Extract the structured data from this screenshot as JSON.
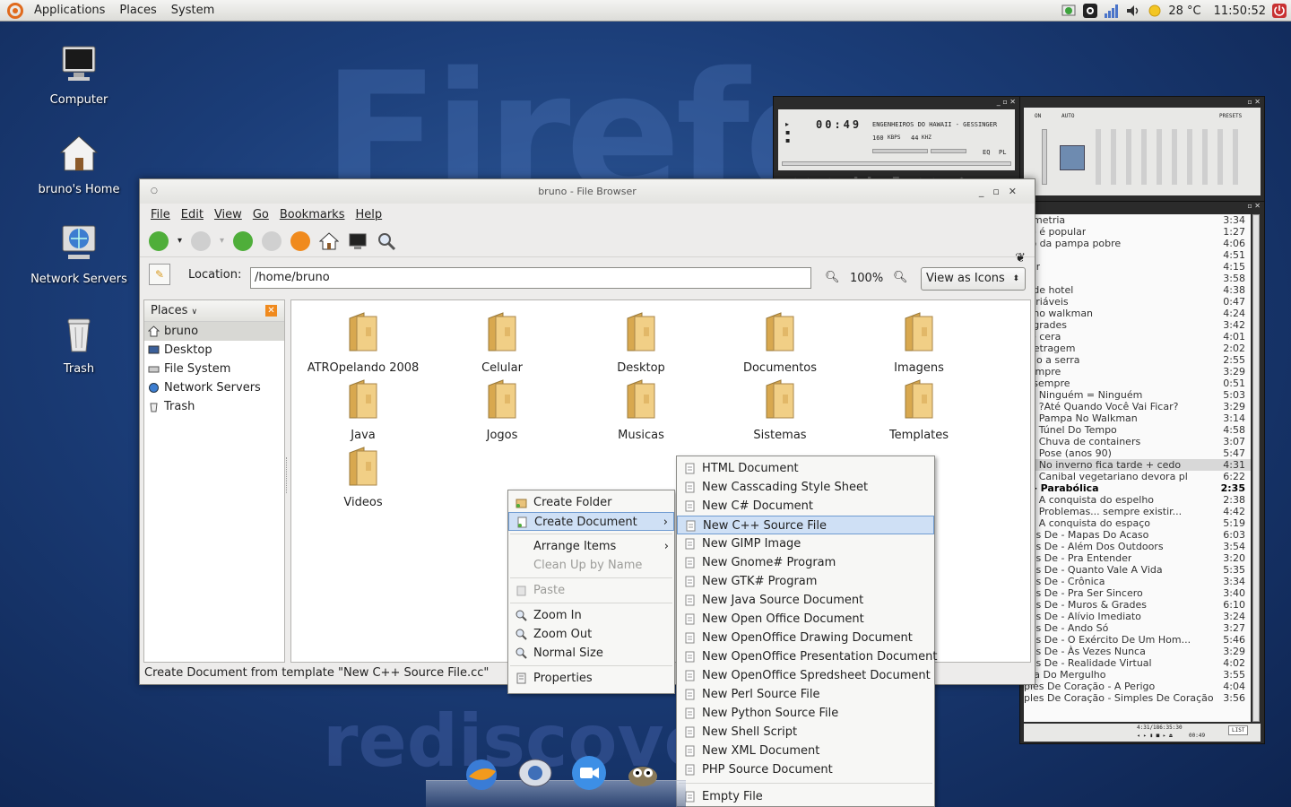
{
  "top_panel": {
    "menus": [
      "Applications",
      "Places",
      "System"
    ],
    "weather": "28 °C",
    "clock": "11:50:52"
  },
  "background": {
    "words": [
      "Firefox",
      "rediscover"
    ]
  },
  "desktop_icons": [
    {
      "label": "Computer",
      "icon": "computer-icon"
    },
    {
      "label": "bruno's Home",
      "icon": "home-icon"
    },
    {
      "label": "Network Servers",
      "icon": "network-icon"
    },
    {
      "label": "Trash",
      "icon": "trash-icon"
    }
  ],
  "player": {
    "time": "00:49",
    "title": "ENGENHEIROS DO HAWAII - GESSINGER",
    "kbps": "160",
    "kbps_unit": "KBPS",
    "khz": "44",
    "khz_unit": "KHZ",
    "eq": "EQ",
    "pl": "PL",
    "eq_on": "ON",
    "eq_auto": "AUTO",
    "eq_presets": "PRESETS"
  },
  "file_browser": {
    "title": "bruno - File Browser",
    "menus": [
      "File",
      "Edit",
      "View",
      "Go",
      "Bookmarks",
      "Help"
    ],
    "location_label": "Location:",
    "location": "/home/bruno",
    "zoom": "100%",
    "view_mode": "View as Icons",
    "sidebar_title": "Places",
    "places": [
      "bruno",
      "Desktop",
      "File System",
      "Network Servers",
      "Trash"
    ],
    "folders": [
      "ATROpelando 2008",
      "Celular",
      "Desktop",
      "Documentos",
      "Imagens",
      "Java",
      "Jogos",
      "Musicas",
      "Sistemas",
      "Templates",
      "Videos"
    ],
    "status": "Create Document from template \"New C++ Source File.cc\""
  },
  "context_menu": [
    {
      "label": "Create Folder",
      "enabled": true
    },
    {
      "label": "Create Document",
      "enabled": true,
      "submenu": true,
      "highlighted": true
    },
    {
      "label": "Arrange Items",
      "enabled": true,
      "submenu": true
    },
    {
      "label": "Clean Up by Name",
      "enabled": false
    },
    {
      "label": "Paste",
      "enabled": false
    },
    {
      "label": "Zoom In",
      "enabled": true
    },
    {
      "label": "Zoom Out",
      "enabled": true
    },
    {
      "label": "Normal Size",
      "enabled": true
    },
    {
      "label": "Properties",
      "enabled": true
    }
  ],
  "document_menu": [
    "HTML Document",
    "New Casscading Style Sheet",
    "New C# Document",
    "New C++ Source File",
    "New GIMP Image",
    "New Gnome# Program",
    "New GTK# Program",
    "New Java Source Document",
    "New Open Office Document",
    "New OpenOffice Drawing Document",
    "New OpenOffice Presentation Document",
    "New OpenOffice Spredsheet Document",
    "New Perl Source File",
    "New Python Source File",
    "New Shell Script",
    "New XML Document",
    "PHP Source Document",
    "Empty File"
  ],
  "document_menu_selected": "New C++ Source File",
  "playlist": [
    {
      "title": "Simetria",
      "time": "3:34"
    },
    {
      "title": "ho é popular",
      "time": "1:27"
    },
    {
      "title": "iro da pampa pobre",
      "time": "4:06"
    },
    {
      "title": "ip",
      "time": "4:51"
    },
    {
      "title": "bar",
      "time": "4:15"
    },
    {
      "title": "só",
      "time": "3:58"
    },
    {
      "title": "o de hotel",
      "time": "4:38"
    },
    {
      "title": "variáveis",
      "time": "0:47"
    },
    {
      "title": "a no walkman",
      "time": "4:24"
    },
    {
      "title": "e grades",
      "time": "3:42"
    },
    {
      "title": "de cera",
      "time": "4:01"
    },
    {
      "title": "metragem",
      "time": "2:02"
    },
    {
      "title": "ndo a serra",
      "time": "2:55"
    },
    {
      "title": "sempre",
      "time": "3:29"
    },
    {
      "title": "é sempre",
      "time": "0:51"
    },
    {
      "title": "z - Ninguém = Ninguém",
      "time": "5:03"
    },
    {
      "title": "z - ?Até Quando Você Vai Ficar?",
      "time": "3:29"
    },
    {
      "title": "z - Pampa No Walkman",
      "time": "3:14"
    },
    {
      "title": "z - Túnel Do Tempo",
      "time": "4:58"
    },
    {
      "title": "z - Chuva de containers",
      "time": "3:07"
    },
    {
      "title": "z - Pose (anos 90)",
      "time": "5:47"
    },
    {
      "title": "z - No inverno fica tarde + cedo",
      "time": "4:31",
      "current": true
    },
    {
      "title": "z - Canibal vegetariano devora pl",
      "time": "6:22"
    },
    {
      "title": "z - Parabólica",
      "time": "2:35",
      "bold": true
    },
    {
      "title": "z - A conquista do espelho",
      "time": "2:38"
    },
    {
      "title": "z - Problemas... sempre existir...",
      "time": "4:42"
    },
    {
      "title": "z - A conquista do espaço",
      "time": "5:19"
    },
    {
      "title": "ões De - Mapas Do Acaso",
      "time": "6:03"
    },
    {
      "title": "ões De - Além Dos Outdoors",
      "time": "3:54"
    },
    {
      "title": "ões De - Pra Entender",
      "time": "3:20"
    },
    {
      "title": "ões De - Quanto Vale A Vida",
      "time": "5:35"
    },
    {
      "title": "ões De - Crônica",
      "time": "3:34"
    },
    {
      "title": "ões De - Pra Ser Sincero",
      "time": "3:40"
    },
    {
      "title": "ões De - Muros & Grades",
      "time": "6:10"
    },
    {
      "title": "ões De - Alívio Imediato",
      "time": "3:24"
    },
    {
      "title": "ões De - Ando Só",
      "time": "3:27"
    },
    {
      "title": "ões De - O Exército De Um Hom...",
      "time": "5:46"
    },
    {
      "title": "ões De - Às Vezes Nunca",
      "time": "3:29"
    },
    {
      "title": "ões De - Realidade Virtual",
      "time": "4:02"
    },
    {
      "title": "ora Do Mergulho",
      "time": "3:55"
    },
    {
      "title": "ples De Coração - A Perigo",
      "time": "4:04"
    },
    {
      "title": "ples De Coração - Simples De Coração",
      "time": "3:56"
    }
  ],
  "playlist_footer": {
    "info": "4:31/186:35:30",
    "clock": "00:49",
    "list_button": "LIST"
  }
}
